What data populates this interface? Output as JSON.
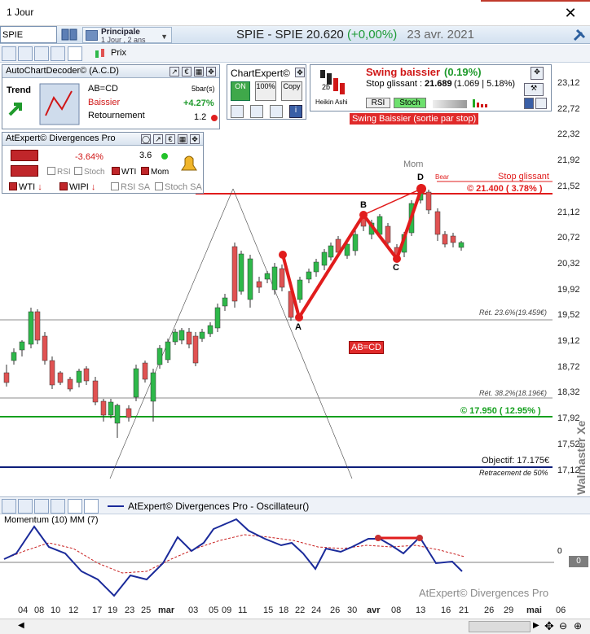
{
  "window": {
    "title": "1 Jour"
  },
  "header": {
    "symbol_value": "SPIE",
    "period_main": "Principale",
    "period_sub": "1 Jour , 2 ans",
    "quote_name": "SPIE - SPIE",
    "quote_price": "20.620",
    "quote_change": "(+0,00%)",
    "quote_date": "23 avr. 2021"
  },
  "toolbar": {
    "prix_label": "Prix"
  },
  "acd": {
    "title": "AutoChartDecoder© (A.C.D)",
    "trend_label": "Trend",
    "pattern": "AB=CD",
    "direction": "Baissier",
    "type": "Retournement",
    "bars_label": "5bar(s)",
    "pct": "+4.27%",
    "ratio": "1.2"
  },
  "divergences": {
    "title": "AtExpert© Divergences Pro",
    "pct": "-3.64%",
    "value": "3.6",
    "rsi": "RSI",
    "stoch": "Stoch",
    "wti": "WTI",
    "mom": "Mom",
    "wti2": "WTI",
    "wipi": "WIPI",
    "rsi_sa": "RSI SA",
    "stoch_sa": "Stoch SA"
  },
  "chartexpert": {
    "title": "ChartExpert©",
    "on": "ON",
    "pct": "100%",
    "copy": "Copy"
  },
  "swing": {
    "title": "Swing baissier",
    "title_pct": "(0.19%)",
    "stop_label": "Stop glissant :",
    "stop_value": "21.689",
    "stop_extra": "(1.069 | 5.18%)",
    "rsi": "RSI",
    "stoch": "Stoch",
    "heikin": "Heikin Ashi",
    "bar_2b": "2b",
    "badge": "Swing Baissier (sortie par stop)"
  },
  "chart": {
    "labels": {
      "stop_glissant": "Stop glissant",
      "stop_level": "© 21.400 ( 3.78% )",
      "target_level": "© 17.950 ( 12.95% )",
      "ret236": "Rét. 23.6%(19.459€)",
      "ret382": "Rét. 38.2%(18.196€)",
      "objectif": "Objectif: 17.175€",
      "retr50": "Retracement de 50%",
      "abcd": "AB=CD",
      "mom": "Mom",
      "bear": "Bear",
      "pt_a": "A",
      "pt_b": "B",
      "pt_c": "C",
      "pt_d": "D"
    },
    "y_axis": [
      "23,12",
      "22,72",
      "22,32",
      "21,92",
      "21,52",
      "21,12",
      "20,72",
      "20,32",
      "19,92",
      "19,52",
      "19,12",
      "18,72",
      "18,32",
      "17,92",
      "17,52",
      "17,12"
    ],
    "dates": [
      "04",
      "08",
      "10",
      "12",
      "17",
      "19",
      "23",
      "25",
      "mar",
      "03",
      "05",
      "09",
      "11",
      "15",
      "18",
      "22",
      "24",
      "26",
      "30",
      "avr",
      "08",
      "13",
      "16",
      "21",
      "26",
      "29",
      "mai",
      "06"
    ],
    "watermark": "Walmaster Xe"
  },
  "oscillator": {
    "title": "AtExpert© Divergences Pro - Oscillateur()",
    "label": "Momentum (10) MM (7)",
    "watermark": "AtExpert© Divergences Pro",
    "zero_value": "0",
    "zero_label": "0"
  },
  "colors": {
    "bull": "#2eb84a",
    "bear": "#e05252",
    "pattern": "#e11c1c",
    "stop": "#e11c1c",
    "target": "#14a01e",
    "objective": "#0d1e7a"
  }
}
